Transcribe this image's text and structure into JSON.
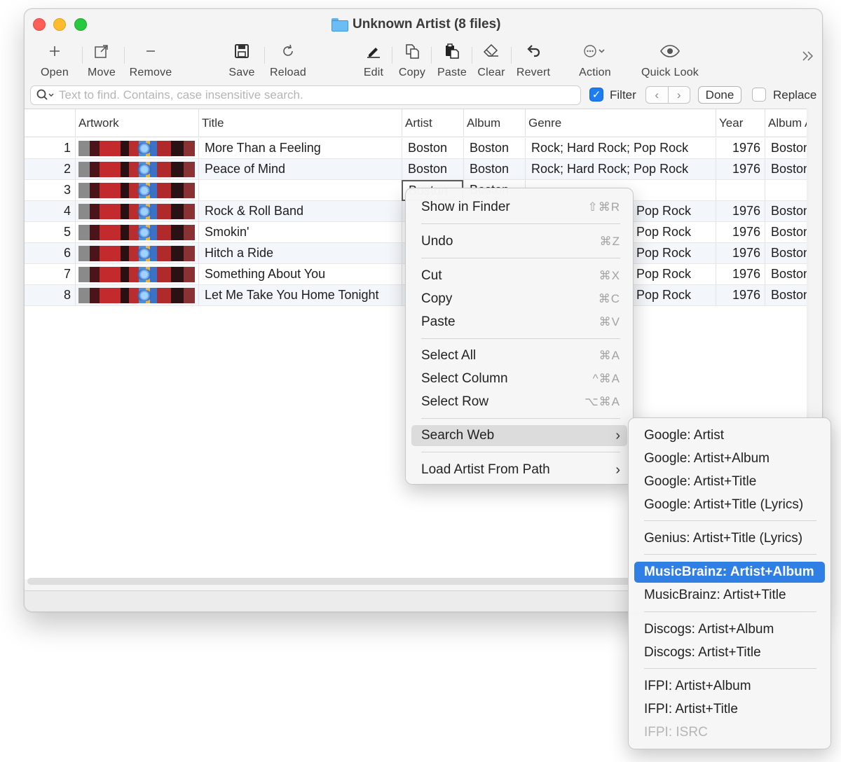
{
  "window": {
    "title": "Unknown Artist (8 files)"
  },
  "toolbar": {
    "open": "Open",
    "move": "Move",
    "remove": "Remove",
    "save": "Save",
    "reload": "Reload",
    "edit": "Edit",
    "copy": "Copy",
    "paste": "Paste",
    "clear": "Clear",
    "revert": "Revert",
    "action": "Action",
    "quick_look": "Quick Look"
  },
  "search": {
    "placeholder": "Text to find. Contains, case insensitive search.",
    "filter_label": "Filter",
    "filter_checked": true,
    "done_label": "Done",
    "replace_label": "Replace",
    "replace_checked": false
  },
  "table": {
    "columns": [
      "Artwork",
      "Title",
      "Artist",
      "Album",
      "Genre",
      "Year",
      "Album A"
    ],
    "rows": [
      {
        "num": "1",
        "title": "More Than a Feeling",
        "artist": "Boston",
        "album": "Boston",
        "genre": "Rock; Hard Rock; Pop Rock",
        "year": "1976",
        "album_artist": "Boston"
      },
      {
        "num": "2",
        "title": "Peace of Mind",
        "artist": "Boston",
        "album": "Boston",
        "genre": "Rock; Hard Rock; Pop Rock",
        "year": "1976",
        "album_artist": "Boston"
      },
      {
        "num": "3",
        "title": "",
        "artist": "Boston",
        "album": "Boston",
        "genre": "",
        "year": "",
        "album_artist": ""
      },
      {
        "num": "4",
        "title": "Rock & Roll Band",
        "artist": "",
        "album": "",
        "genre": "Pop Rock",
        "year": "1976",
        "album_artist": "Boston"
      },
      {
        "num": "5",
        "title": "Smokin'",
        "artist": "",
        "album": "",
        "genre": "Pop Rock",
        "year": "1976",
        "album_artist": "Boston"
      },
      {
        "num": "6",
        "title": "Hitch a Ride",
        "artist": "",
        "album": "",
        "genre": "Pop Rock",
        "year": "1976",
        "album_artist": "Boston"
      },
      {
        "num": "7",
        "title": "Something About You",
        "artist": "",
        "album": "",
        "genre": "Pop Rock",
        "year": "1976",
        "album_artist": "Boston"
      },
      {
        "num": "8",
        "title": "Let Me Take You Home Tonight",
        "artist": "",
        "album": "",
        "genre": "Pop Rock",
        "year": "1976",
        "album_artist": "Boston"
      }
    ]
  },
  "context_menu": {
    "show_in_finder": {
      "label": "Show in Finder",
      "shortcut": "⇧⌘R"
    },
    "undo": {
      "label": "Undo",
      "shortcut": "⌘Z"
    },
    "cut": {
      "label": "Cut",
      "shortcut": "⌘X"
    },
    "copy": {
      "label": "Copy",
      "shortcut": "⌘C"
    },
    "paste": {
      "label": "Paste",
      "shortcut": "⌘V"
    },
    "select_all": {
      "label": "Select All",
      "shortcut": "⌘A"
    },
    "select_column": {
      "label": "Select Column",
      "shortcut": "^⌘A"
    },
    "select_row": {
      "label": "Select Row",
      "shortcut": "⌥⌘A"
    },
    "search_web": {
      "label": "Search Web"
    },
    "load_artist": {
      "label": "Load Artist From Path"
    }
  },
  "submenu": {
    "items": [
      "Google: Artist",
      "Google: Artist+Album",
      "Google: Artist+Title",
      "Google: Artist+Title (Lyrics)",
      "Genius: Artist+Title (Lyrics)",
      "MusicBrainz: Artist+Album",
      "MusicBrainz: Artist+Title",
      "Discogs: Artist+Album",
      "Discogs: Artist+Title",
      "IFPI: Artist+Album",
      "IFPI: Artist+Title",
      "IFPI: ISRC"
    ],
    "highlighted": "MusicBrainz: Artist+Album",
    "disabled": "IFPI: ISRC"
  },
  "colors": {
    "accent": "#2f7fe5",
    "close": "#ff5f57",
    "minimize": "#febc2e",
    "zoom": "#28c840"
  }
}
